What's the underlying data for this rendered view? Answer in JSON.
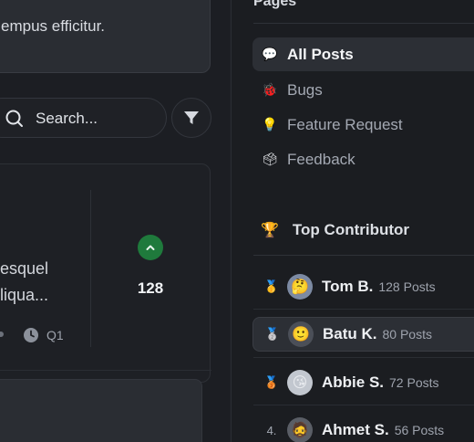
{
  "feed": {
    "top_card_text": "empus efficitur.",
    "search": {
      "placeholder": "Search..."
    },
    "post": {
      "excerpt_line1": "esquel",
      "excerpt_line2": "liqua...",
      "votes": "128",
      "meta_label": "Q1"
    }
  },
  "sidebar": {
    "pages_title": "Pages",
    "pages": [
      {
        "label": "All Posts",
        "icon": "speech-bubble-icon",
        "emoji": "💬"
      },
      {
        "label": "Bugs",
        "icon": "bug-icon",
        "emoji": "🐞"
      },
      {
        "label": "Feature Request",
        "icon": "light-bulb-icon",
        "emoji": "💡"
      },
      {
        "label": "Feedback",
        "icon": "ballot-box-icon",
        "emoji": "🗳"
      }
    ],
    "contrib_title": "Top Contributor",
    "contrib_emoji": "🏆",
    "contributors": [
      {
        "rank": "🥇",
        "name": "Tom B.",
        "posts": "128 Posts",
        "avatar": "🤔"
      },
      {
        "rank": "🥈",
        "name": "Batu K.",
        "posts": "80 Posts",
        "avatar": "🙂"
      },
      {
        "rank": "🥉",
        "name": "Abbie S.",
        "posts": "72 Posts",
        "avatar": "😘"
      },
      {
        "rank": "4.",
        "name": "Ahmet S.",
        "posts": "56 Posts",
        "avatar": "🧔"
      }
    ]
  },
  "colors": {
    "accent_green": "#1f7a3c",
    "active_bg": "#2c2f35"
  }
}
